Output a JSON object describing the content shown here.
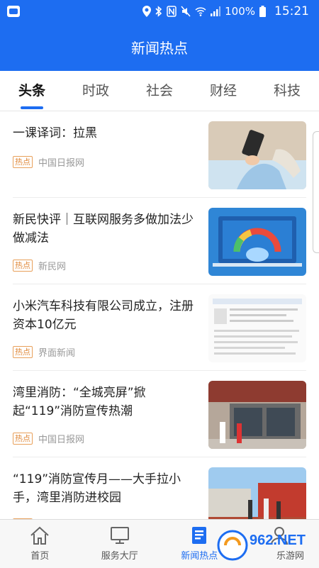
{
  "status_bar": {
    "battery": "100%",
    "time": "15:21"
  },
  "header": {
    "title": "新闻热点"
  },
  "tabs": [
    {
      "label": "头条",
      "active": true
    },
    {
      "label": "时政",
      "active": false
    },
    {
      "label": "社会",
      "active": false
    },
    {
      "label": "财经",
      "active": false
    },
    {
      "label": "科技",
      "active": false
    }
  ],
  "news": [
    {
      "title": "一课译词：拉黑",
      "badge": "热点",
      "source": "中国日报网",
      "thumb_icon": "phone-reading-photo"
    },
    {
      "title": "新民快评｜互联网服务多做加法少做减法",
      "badge": "热点",
      "source": "新民网",
      "thumb_icon": "laptop-gauge-photo"
    },
    {
      "title": "小米汽车科技有限公司成立，注册资本10亿元",
      "badge": "热点",
      "source": "界面新闻",
      "thumb_icon": "company-registration-photo"
    },
    {
      "title": "湾里消防：“全城亮屏”掀起“119”消防宣传热潮",
      "badge": "热点",
      "source": "中国日报网",
      "thumb_icon": "visitor-center-photo"
    },
    {
      "title": "“119”消防宣传月——大手拉小手，湾里消防进校园",
      "badge": "热点",
      "source": "",
      "thumb_icon": "school-yard-photo"
    }
  ],
  "bottom_nav": [
    {
      "label": "首页",
      "icon": "home-icon",
      "active": false
    },
    {
      "label": "服务大厅",
      "icon": "monitor-icon",
      "active": false
    },
    {
      "label": "新闻热点",
      "icon": "news-icon",
      "active": true
    },
    {
      "label": "",
      "icon": "user-icon",
      "active": false
    }
  ],
  "watermark": {
    "text": "962.NET",
    "subtext": "乐游网"
  },
  "colors": {
    "primary": "#1d6df1",
    "badge": "#e08a3c"
  }
}
